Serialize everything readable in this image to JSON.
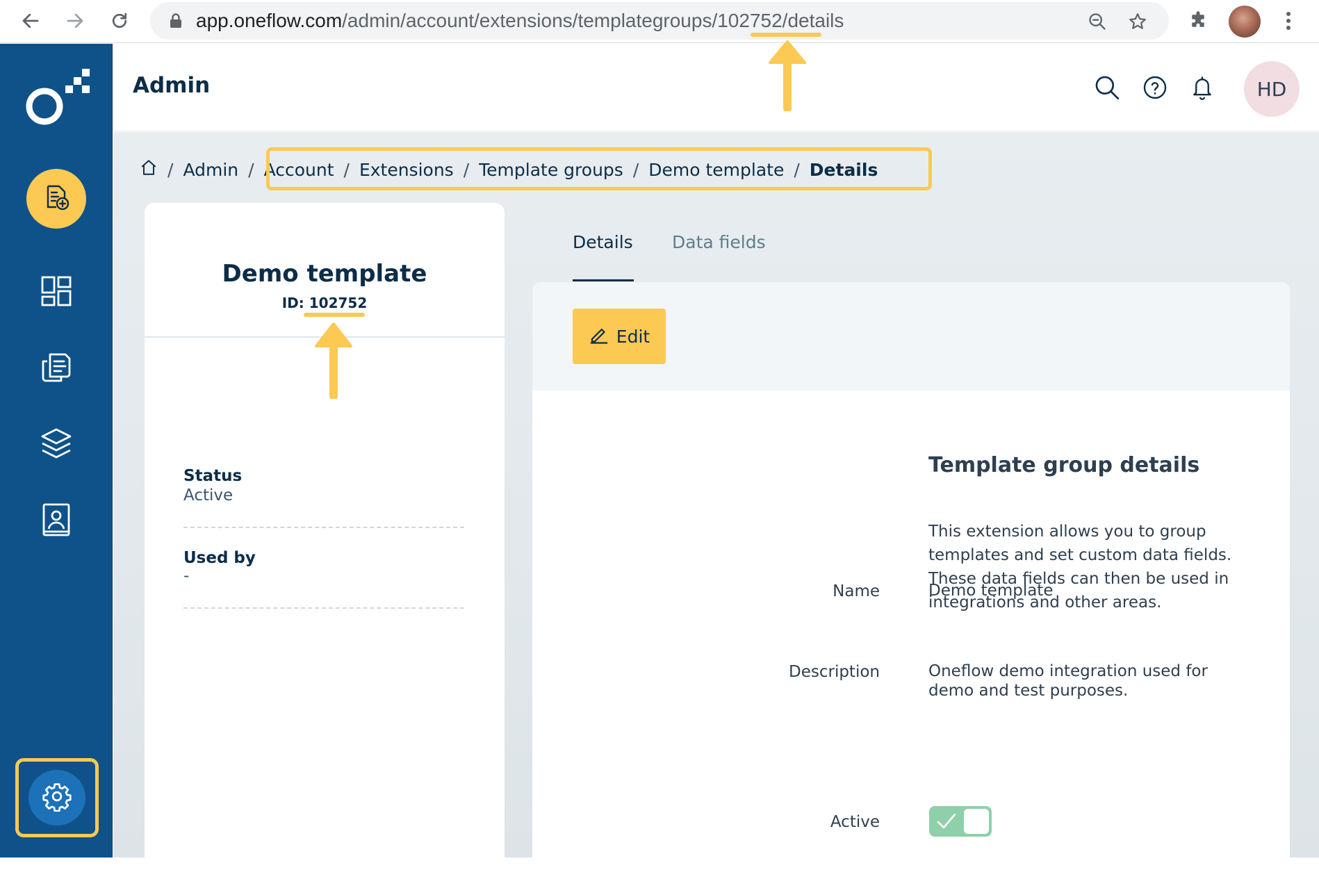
{
  "browser": {
    "url_host": "app.oneflow.com",
    "url_path_before_id": "/admin/account/extensions/templategroups/",
    "url_id": "102752",
    "url_path_after_id": "/details"
  },
  "header": {
    "title": "Admin",
    "avatar_initials": "HD"
  },
  "breadcrumb": {
    "items": [
      "Admin",
      "Account",
      "Extensions",
      "Template groups",
      "Demo template",
      "Details"
    ],
    "separator": "/"
  },
  "side_card": {
    "title": "Demo template",
    "id_label": "ID:",
    "id_value": "102752",
    "status_label": "Status",
    "status_value": "Active",
    "used_by_label": "Used by",
    "used_by_value": "-"
  },
  "tabs": [
    {
      "label": "Details",
      "active": true
    },
    {
      "label": "Data fields",
      "active": false
    }
  ],
  "toolbar": {
    "edit_label": "Edit"
  },
  "details": {
    "section_title": "Template group details",
    "description": "This extension allows you to group templates and set custom data fields. These data fields can then be used in integrations and other areas.",
    "name_label": "Name",
    "name_value": "Demo template",
    "description_label": "Description",
    "description_value": "Oneflow demo integration used for demo and test purposes.",
    "active_label": "Active",
    "active_value": true
  },
  "colors": {
    "sidebar": "#0e5289",
    "accent": "#fcc953",
    "toggle_on": "#8fd0aa",
    "text_dark": "#0c2d48"
  },
  "icons": [
    "back-arrow-icon",
    "forward-arrow-icon",
    "reload-icon",
    "lock-icon",
    "zoom-icon",
    "star-icon",
    "puzzle-icon",
    "kebab-menu-icon",
    "oneflow-logo",
    "create-document-icon",
    "dashboard-icon",
    "documents-icon",
    "templates-layers-icon",
    "address-book-icon",
    "gear-icon",
    "search-icon",
    "help-icon",
    "bell-icon",
    "home-icon",
    "pencil-icon",
    "check-icon"
  ]
}
